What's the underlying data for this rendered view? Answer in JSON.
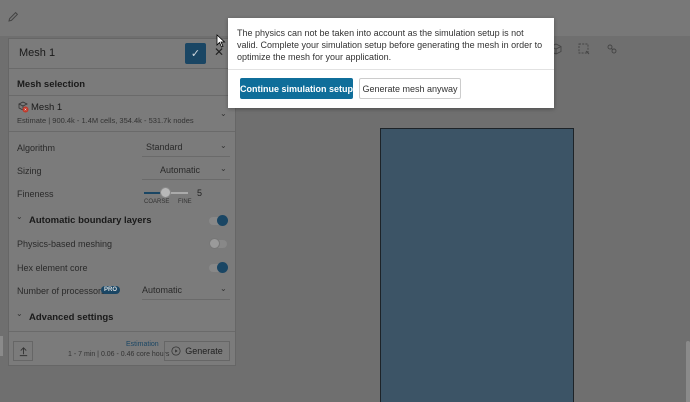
{
  "topbar": {
    "edit_icon": "pencil-icon"
  },
  "panel": {
    "title": "Mesh 1",
    "confirm_icon": "check-icon",
    "close_icon": "close-icon",
    "mesh_selection": {
      "label": "Mesh selection",
      "item_title": "Mesh 1",
      "item_estimate": "Estimate | 900.4k - 1.4M cells, 354.4k - 531.7k nodes"
    },
    "algorithm": {
      "label": "Algorithm",
      "value": "Standard"
    },
    "sizing": {
      "label": "Sizing",
      "value": "Automatic"
    },
    "fineness": {
      "label": "Fineness",
      "value": "5",
      "min_label": "COARSE",
      "max_label": "FINE"
    },
    "automatic_boundary_layers": {
      "label": "Automatic boundary layers",
      "enabled": true
    },
    "physics_based_meshing": {
      "label": "Physics-based meshing",
      "enabled": false
    },
    "hex_element_core": {
      "label": "Hex element core",
      "enabled": true
    },
    "processors": {
      "label": "Number of processors",
      "badge": "PRO",
      "value": "Automatic"
    },
    "advanced": {
      "label": "Advanced settings"
    },
    "footer": {
      "estimation_label": "Estimation",
      "estimation_detail": "1 - 7 min | 0.06 - 0.46 core hours",
      "generate_label": "Generate"
    }
  },
  "dialog": {
    "message": "The physics can not be taken into account as the simulation setup is not valid. Complete your simulation setup before generating the mesh in order to optimize the mesh for your application.",
    "primary_button": "Continue simulation setup",
    "secondary_button": "Generate mesh anyway"
  },
  "colors": {
    "accent": "#0f6e9a",
    "geometry_fill": "#3c5466",
    "overlay": "#6f6f6f"
  }
}
